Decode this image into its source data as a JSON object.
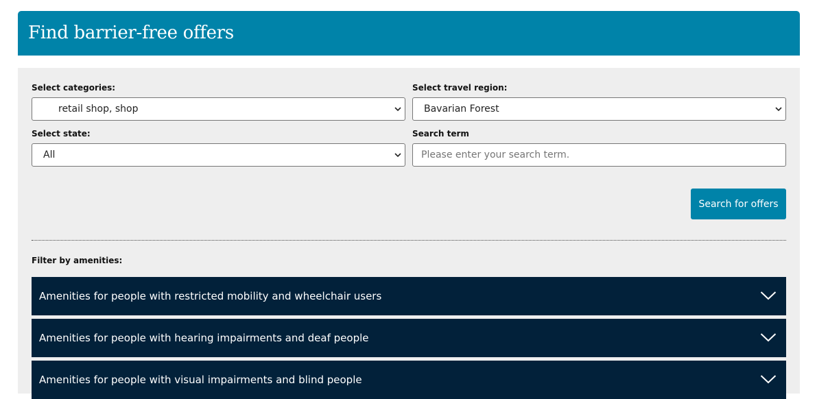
{
  "header": {
    "title": "Find barrier-free offers"
  },
  "form": {
    "categories": {
      "label": "Select categories:",
      "value": "retail shop, shop"
    },
    "region": {
      "label": "Select travel region:",
      "value": "Bavarian Forest"
    },
    "state": {
      "label": "Select state:",
      "value": "All"
    },
    "search": {
      "label": "Search term",
      "placeholder": "Please enter your search term."
    },
    "submit_label": "Search for offers"
  },
  "filters": {
    "label": "Filter by amenities:",
    "items": [
      {
        "label": "Amenities for people with restricted mobility and wheelchair users",
        "icon": "chevron-down-icon"
      },
      {
        "label": "Amenities for people with hearing impairments and deaf people",
        "icon": "chevron-down-icon"
      },
      {
        "label": "Amenities for people with visual impairments and blind people",
        "icon": "chevron-down-icon"
      }
    ]
  },
  "colors": {
    "header_bg": "#0083a9",
    "panel_bg": "#eeeeee",
    "button_bg": "#0083a9",
    "accordion_bg": "#02213a"
  }
}
